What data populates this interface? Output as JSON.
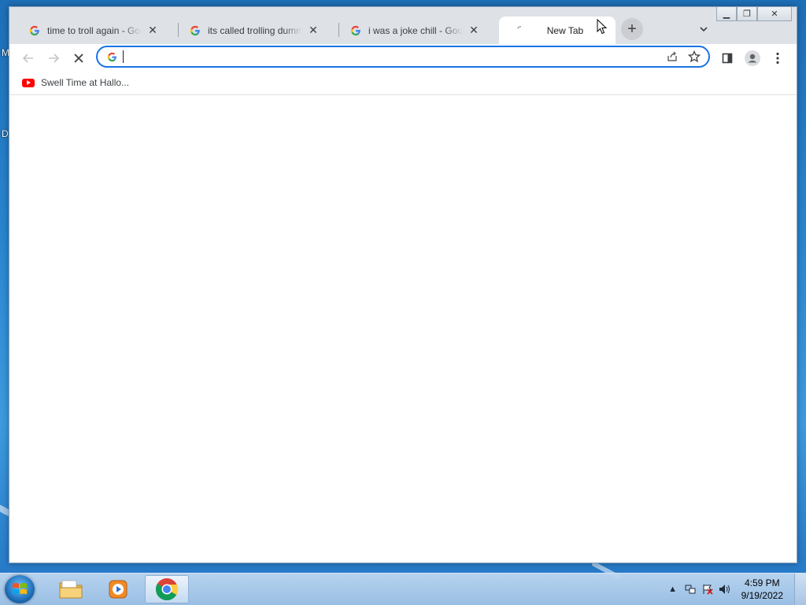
{
  "desktop": {
    "edge_letters": [
      "M",
      "D"
    ]
  },
  "browser": {
    "tabs": [
      {
        "title": "time to troll again - Google",
        "favicon": "google-g-icon",
        "active": false
      },
      {
        "title": "its called trolling dummy - G",
        "favicon": "google-g-icon",
        "active": false
      },
      {
        "title": "i was a joke chill - Google Se",
        "favicon": "google-g-icon",
        "active": false
      },
      {
        "title": "New Tab",
        "favicon": "loading-spinner-icon",
        "active": true
      }
    ],
    "new_tab_symbol": "+",
    "toolbar": {
      "back_icon": "back-arrow-icon",
      "forward_icon": "forward-arrow-icon",
      "stop_icon": "stop-x-icon",
      "omnibox_value": "",
      "omnibox_placeholder": ""
    },
    "bookmarks": [
      {
        "label": "Swell Time at Hallo...",
        "icon": "youtube-icon"
      }
    ]
  },
  "taskbar": {
    "apps": [
      {
        "name": "windows-explorer",
        "active": false
      },
      {
        "name": "windows-media-player",
        "active": false
      },
      {
        "name": "google-chrome",
        "active": true
      }
    ],
    "clock": {
      "time": "4:59 PM",
      "date": "9/19/2022"
    }
  },
  "colors": {
    "accent": "#1a73e8",
    "tabstrip": "#dee1e6",
    "desktop": "#2a86cf"
  }
}
